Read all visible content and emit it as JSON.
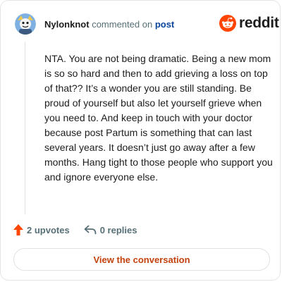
{
  "header": {
    "username": "Nylonknot",
    "action_text": "commented on",
    "post_link": "post"
  },
  "brand": {
    "logo_text": "reddit",
    "color": "#ff4500"
  },
  "comment": {
    "body": "NTA. You are not being dramatic. Being a new mom is so so hard and then to add grieving a loss on top of that?? It’s a wonder you are still standing. Be proud of yourself but also let yourself grieve when you need to. And keep in touch with your doctor because post Partum is something that can last several years. It doesn’t just go away after a few months. Hang tight to those people who support you and ignore everyone else."
  },
  "actions": {
    "upvotes_label": "2 upvotes",
    "replies_label": "0 replies",
    "upvote_icon": "upvote-arrow-icon",
    "reply_icon": "reply-arrow-icon"
  },
  "cta": {
    "label": "View the conversation"
  },
  "colors": {
    "text": "#1c1c1c",
    "muted": "#576f76",
    "link": "#0a449b",
    "cta_text": "#c2410c",
    "upvote": "#ff4500"
  }
}
